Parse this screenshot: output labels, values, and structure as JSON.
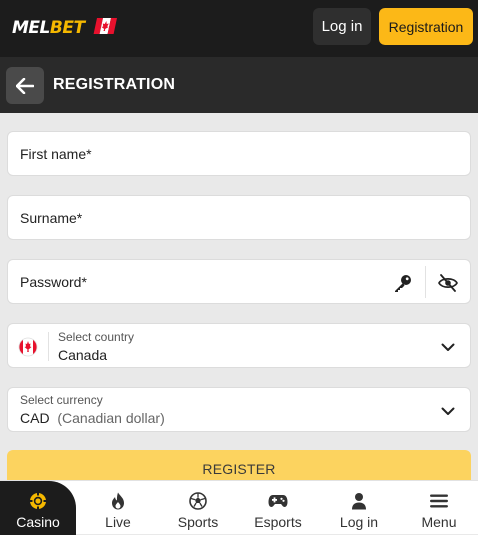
{
  "header": {
    "logo_part1": "MEL",
    "logo_part2": "BET",
    "login_label": "Log in",
    "registration_label": "Registration"
  },
  "page": {
    "title": "REGISTRATION"
  },
  "form": {
    "first_name_placeholder": "First name*",
    "surname_placeholder": "Surname*",
    "password_placeholder": "Password*",
    "country_label": "Select country",
    "country_value": "Canada",
    "currency_label": "Select currency",
    "currency_code": "CAD",
    "currency_name": "(Canadian dollar)",
    "register_label": "REGISTER"
  },
  "bottom_nav": [
    {
      "label": "Casino",
      "icon": "casino-chip-icon",
      "active": true
    },
    {
      "label": "Live",
      "icon": "flame-icon",
      "active": false
    },
    {
      "label": "Sports",
      "icon": "soccer-ball-icon",
      "active": false
    },
    {
      "label": "Esports",
      "icon": "gamepad-icon",
      "active": false
    },
    {
      "label": "Log in",
      "icon": "user-icon",
      "active": false
    },
    {
      "label": "Menu",
      "icon": "hamburger-icon",
      "active": false
    }
  ],
  "colors": {
    "brand_yellow": "#fcb817",
    "header_bg": "#1c1c1c",
    "titlebar_bg": "#2a2a2a",
    "register_button": "#fcd35f",
    "canada_red": "#e8112d"
  }
}
